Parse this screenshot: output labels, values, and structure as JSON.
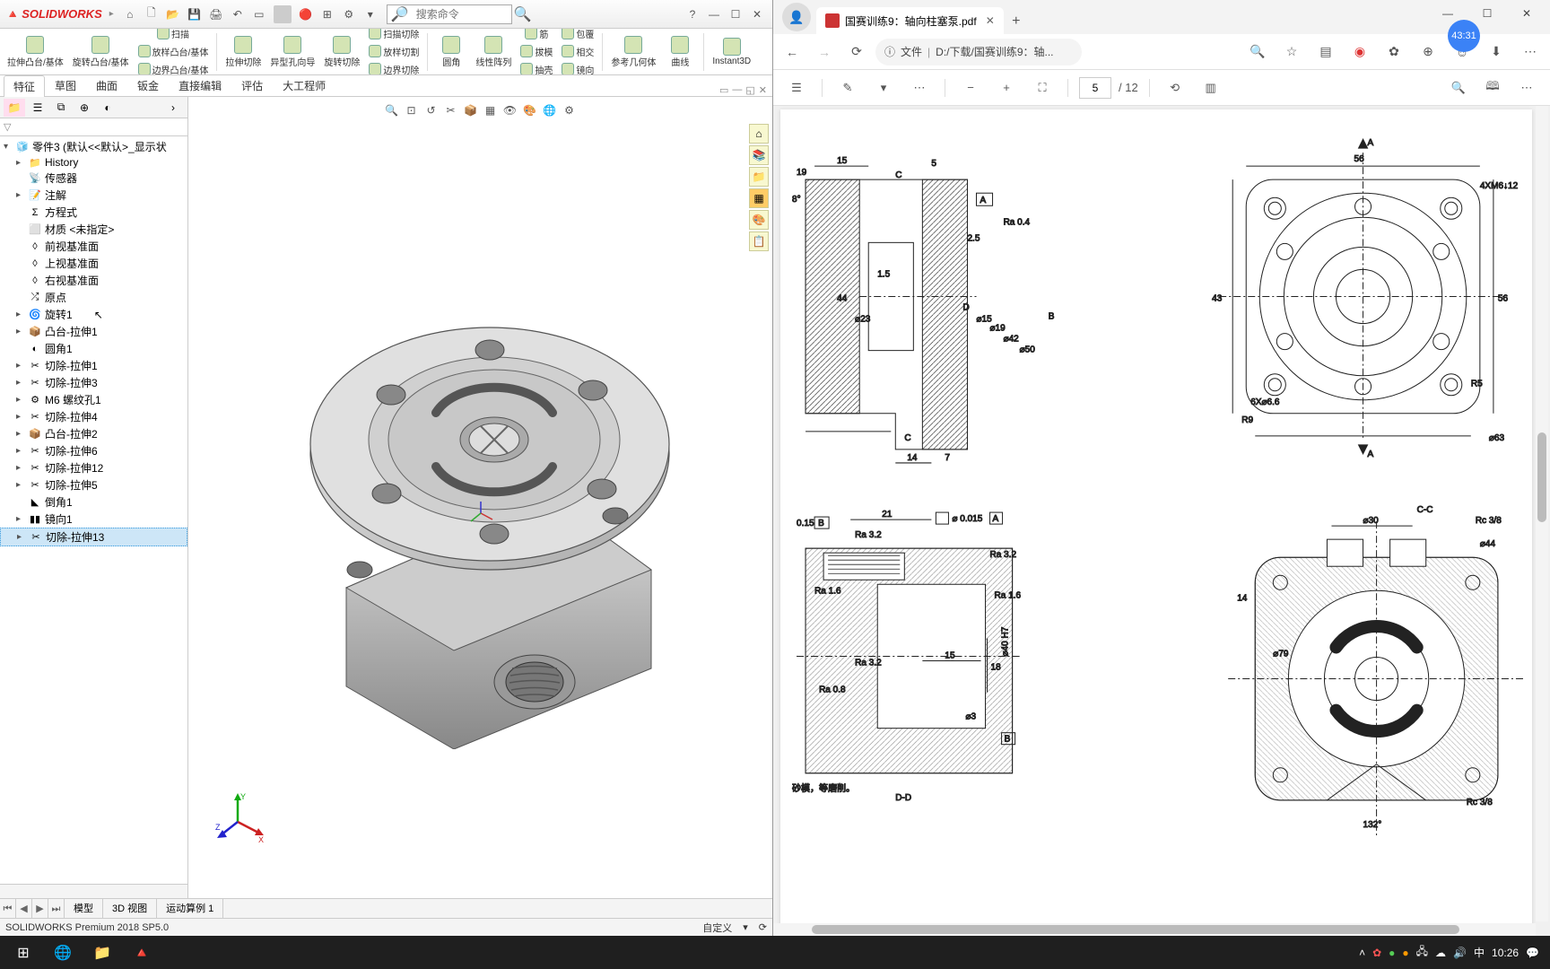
{
  "sw": {
    "app_name": "SOLIDWORKS",
    "search_placeholder": "搜索命令",
    "ribbon": {
      "b1": "拉伸凸台/基体",
      "b2": "旋转凸台/基体",
      "b3": "扫描",
      "b4": "放样凸台/基体",
      "b5": "边界凸台/基体",
      "b6": "拉伸切除",
      "b7": "异型孔向导",
      "b8": "旋转切除",
      "b9": "扫描切除",
      "b10": "放样切割",
      "b11": "边界切除",
      "b12": "圆角",
      "b13": "线性阵列",
      "b14": "筋",
      "b15": "拔模",
      "b16": "抽壳",
      "b17": "包覆",
      "b18": "相交",
      "b19": "镜向",
      "b20": "参考几何体",
      "b21": "曲线",
      "b22": "Instant3D"
    },
    "tabs": {
      "t1": "特征",
      "t2": "草图",
      "t3": "曲面",
      "t4": "钣金",
      "t5": "直接编辑",
      "t6": "评估",
      "t7": "大工程师"
    },
    "tree": {
      "root": "零件3 (默认<<默认>_显示状",
      "n1": "History",
      "n2": "传感器",
      "n3": "注解",
      "n4": "方程式",
      "n5": "材质 <未指定>",
      "n6": "前视基准面",
      "n7": "上视基准面",
      "n8": "右视基准面",
      "n9": "原点",
      "n10": "旋转1",
      "n11": "凸台-拉伸1",
      "n12": "圆角1",
      "n13": "切除-拉伸1",
      "n14": "切除-拉伸3",
      "n15": "M6 螺纹孔1",
      "n16": "切除-拉伸4",
      "n17": "凸台-拉伸2",
      "n18": "切除-拉伸6",
      "n19": "切除-拉伸12",
      "n20": "切除-拉伸5",
      "n21": "倒角1",
      "n22": "镜向1",
      "n23": "切除-拉伸13"
    },
    "bottom_tabs": {
      "t1": "模型",
      "t2": "3D 视图",
      "t3": "运动算例 1"
    },
    "status": {
      "left": "SOLIDWORKS Premium 2018 SP5.0",
      "mode": "自定义"
    }
  },
  "edge": {
    "tab_title": "国赛训练9：轴向柱塞泵.pdf",
    "url_prefix": "文件",
    "url": "D:/下载/国赛训练9：轴...",
    "pdf": {
      "page": "5",
      "total": "/ 12"
    },
    "badge": "43:31"
  },
  "drawing": {
    "d1": "56",
    "d2": "4XM6↓12",
    "d3": "43",
    "d4": "56",
    "d5": "R5",
    "d6": "⌀63",
    "d7": "R9",
    "d8": "6X⌀6.6",
    "d9": "A",
    "d10": "A",
    "d11": "19",
    "d12": "15",
    "d13": "5",
    "d14": "C",
    "d15": "A",
    "d16": "8°",
    "d17": "Ra 0.4",
    "d18": "2.5",
    "d19": "44",
    "d20": "1.5",
    "d21": "⌀23",
    "d22": "D",
    "d23": "⌀15",
    "d24": "⌀19",
    "d25": "⌀42",
    "d26": "⌀50",
    "d27": "B",
    "d28": "C",
    "d29": "14",
    "d30": "7",
    "d31": "C-C",
    "d32": "Rc 3/8",
    "d33": "⌀30",
    "d34": "⌀44",
    "d35": "14",
    "d36": "⌀79",
    "d37": "132°",
    "d38": "Rc 3/8",
    "d39": "0.15",
    "d40": "B",
    "d41": "21",
    "d42": "⌀ 0.015",
    "d43": "A",
    "d44": "Ra 3.2",
    "d45": "Ra 1.6",
    "d46": "Ra 1.6",
    "d47": "Ra 3.2",
    "d48": "Ra 0.8",
    "d49": "15",
    "d50": "18",
    "d51": "⌀3",
    "d52": "B",
    "d53": "⌀40 H7",
    "d54": "D-D",
    "d55": "砂模，等磨削。",
    "d56": "Ra 3.2"
  },
  "taskbar": {
    "time": "10:26",
    "ime": "中"
  }
}
